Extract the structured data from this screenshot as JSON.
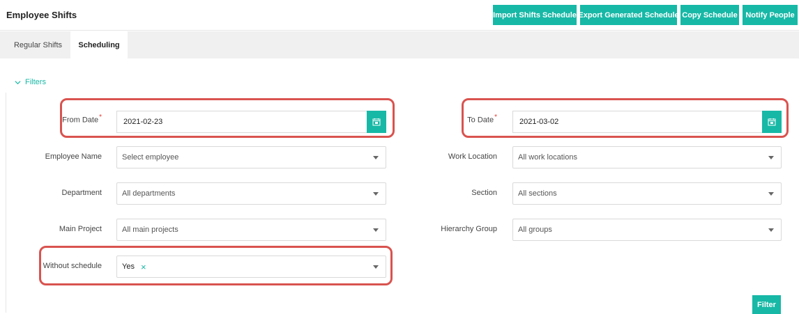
{
  "header": {
    "title": "Employee Shifts",
    "buttons": {
      "import": "Import Shifts Schedule",
      "export": "Export Generated Schedule",
      "copy": "Copy Schedule",
      "notify": "Notify People"
    }
  },
  "tabs": {
    "regular": "Regular Shifts",
    "scheduling": "Scheduling",
    "active": "Scheduling"
  },
  "filters": {
    "toggle_label": "Filters",
    "from_date": {
      "label": "From Date",
      "value": "2021-02-23",
      "required": "*"
    },
    "to_date": {
      "label": "To Date",
      "value": "2021-03-02",
      "required": "*"
    },
    "employee_name": {
      "label": "Employee Name",
      "placeholder": "Select employee"
    },
    "work_location": {
      "label": "Work Location",
      "value": "All work locations"
    },
    "department": {
      "label": "Department",
      "value": "All departments"
    },
    "section": {
      "label": "Section",
      "value": "All sections"
    },
    "main_project": {
      "label": "Main Project",
      "value": "All main projects"
    },
    "hierarchy_group": {
      "label": "Hierarchy Group",
      "value": "All groups"
    },
    "without_schedule": {
      "label": "Without schedule",
      "value": "Yes",
      "clear_symbol": "×"
    },
    "submit": "Filter"
  },
  "colors": {
    "accent": "#17b8a6",
    "highlight": "#d9534f",
    "required": "#e53935"
  },
  "icons": [
    "calendar-icon",
    "chevron-down-icon",
    "dropdown-caret-icon",
    "clear-icon"
  ]
}
